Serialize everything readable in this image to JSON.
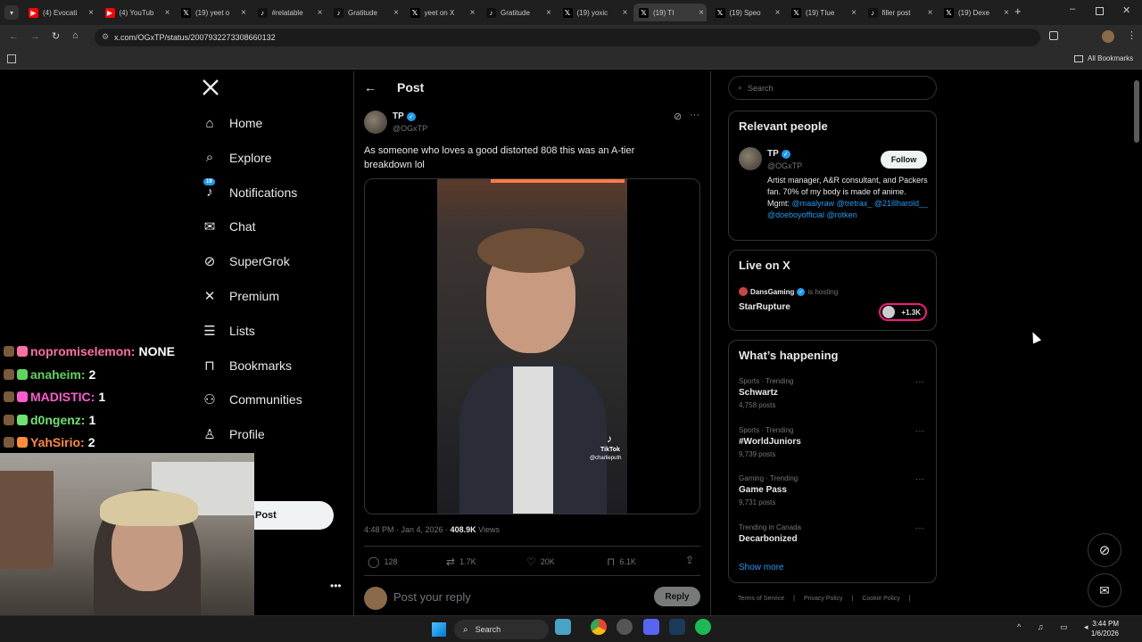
{
  "browser": {
    "tabs": [
      {
        "label": "(4) Evocati",
        "icon": "youtube"
      },
      {
        "label": "(4) YouTub",
        "icon": "youtube"
      },
      {
        "label": "(19) yeet o",
        "icon": "x"
      },
      {
        "label": "#relatable",
        "icon": "tiktok"
      },
      {
        "label": "Gratitude",
        "icon": "tiktok"
      },
      {
        "label": "yeet on X",
        "icon": "x"
      },
      {
        "label": "Gratitude",
        "icon": "tiktok"
      },
      {
        "label": "(19) yoxic",
        "icon": "x"
      },
      {
        "label": "(19) TI",
        "icon": "x"
      },
      {
        "label": "(19) Speo",
        "icon": "x"
      },
      {
        "label": "(19) TIue",
        "icon": "x"
      },
      {
        "label": "filler post",
        "icon": "tiktok"
      },
      {
        "label": "(19) Dexe",
        "icon": "x"
      }
    ],
    "url": "x.com/OGxTP/status/2007932273308660132",
    "bookmarks_label": "All Bookmarks"
  },
  "nav": {
    "items": [
      {
        "label": "Home",
        "icon": "home-icon"
      },
      {
        "label": "Explore",
        "icon": "search-icon"
      },
      {
        "label": "Notifications",
        "icon": "bell-icon",
        "badge": "19"
      },
      {
        "label": "Chat",
        "icon": "mail-icon"
      },
      {
        "label": "SuperGrok",
        "icon": "grok-icon"
      },
      {
        "label": "Premium",
        "icon": "x-logo-icon"
      },
      {
        "label": "Lists",
        "icon": "list-icon"
      },
      {
        "label": "Bookmarks",
        "icon": "bookmark-icon"
      },
      {
        "label": "Communities",
        "icon": "people-icon"
      },
      {
        "label": "Profile",
        "icon": "person-icon"
      }
    ],
    "post_button": "Post"
  },
  "post": {
    "header": "Post",
    "author_name": "TP",
    "author_handle": "@OGxTP",
    "text": "As someone who loves a good distorted 808 this was an A-tier breakdown lol",
    "video_watermark": "TikTok",
    "video_handle": "@charlieputh",
    "time": "4:48 PM · Jan 4, 2026 ·",
    "views_count": "408.9K",
    "views_label": "Views",
    "replies": "128",
    "reposts": "1.7K",
    "likes": "20K",
    "bookmarks": "6.1K",
    "reply_placeholder": "Post your reply",
    "reply_button": "Reply"
  },
  "sidebar": {
    "search_placeholder": "Search",
    "relevant_title": "Relevant people",
    "person_name": "TP",
    "person_handle": "@OGxTP",
    "follow_label": "Follow",
    "bio_text": "Artist manager, A&R consultant, and Packers fan. 70% of my body is made of anime. Mgmt:",
    "bio_links": "@maalyraw @tretrax_ @21lllharold__ @doeboyofficial @rotken",
    "live_title": "Live on X",
    "live_host": "DansGaming",
    "live_hosting": "is hosting",
    "live_stream": "StarRupture",
    "live_count": "+1.3K",
    "happening_title": "What’s happening",
    "trends": [
      {
        "meta": "Sports · Trending",
        "name": "Schwartz",
        "posts": "4,758 posts"
      },
      {
        "meta": "Sports · Trending",
        "name": "#WorldJuniors",
        "posts": "9,739 posts"
      },
      {
        "meta": "Gaming · Trending",
        "name": "Game Pass",
        "posts": "9,731 posts"
      },
      {
        "meta": "Trending in Canada",
        "name": "Decarbonized",
        "posts": ""
      }
    ],
    "show_more": "Show more",
    "footer_links": [
      "Terms of Service",
      "Privacy Policy",
      "Cookie Policy"
    ]
  },
  "chat": [
    {
      "user": "nopromiselemon",
      "msg": "NONE",
      "color": "#ff6fa8"
    },
    {
      "user": "anaheim",
      "msg": "2",
      "color": "#5cd65c"
    },
    {
      "user": "MADISTIC",
      "msg": "1",
      "color": "#ff5bd1"
    },
    {
      "user": "d0ngenz",
      "msg": "1",
      "color": "#6fe36f"
    },
    {
      "user": "YahSirio",
      "msg": "2",
      "color": "#ff8c3a"
    }
  ],
  "taskbar": {
    "search_label": "Search",
    "time": "3:44 PM",
    "date": "1/6/2026"
  },
  "colors": {
    "accent": "#1d9bf0",
    "link": "#1d9bf0",
    "border": "#2f3336"
  }
}
